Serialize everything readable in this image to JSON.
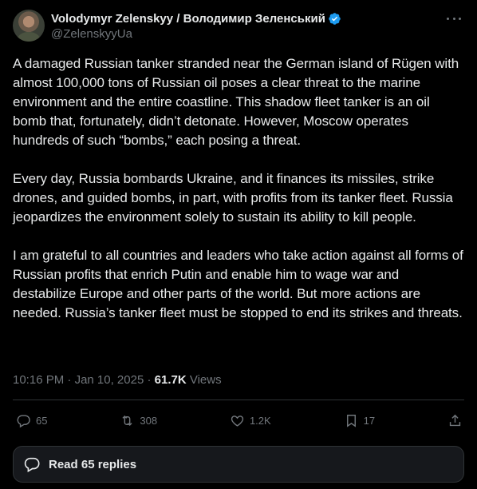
{
  "author": {
    "display_name": "Volodymyr Zelenskyy / Володимир Зеленський",
    "handle": "@ZelenskyyUa",
    "verified_badge_icon": "verified-check-icon",
    "verified_color": "#1d9bf0"
  },
  "post": {
    "paragraphs": [
      "A damaged Russian tanker stranded near the German island of Rügen with almost 100,000 tons of Russian oil poses a clear threat to the marine environment and the entire coastline. This shadow fleet tanker is an oil bomb that, fortunately, didn’t detonate. However, Moscow operates hundreds of such “bombs,” each posing a threat.",
      "Every day, Russia bombards Ukraine, and it finances its missiles, strike drones, and guided bombs, in part, with profits from its tanker fleet. Russia jeopardizes the environment solely to sustain its ability to kill people.",
      "I am grateful to all countries and leaders who take action against all forms of Russian profits that enrich Putin and enable him to wage war and destabilize Europe and other parts of the world. But more actions are needed. Russia’s tanker fleet must be stopped to end its strikes and threats."
    ],
    "time": "10:16 PM",
    "separator": " · ",
    "date": "Jan 10, 2025",
    "views_count": "61.7K",
    "views_label": "Views"
  },
  "actions": {
    "replies": "65",
    "reposts": "308",
    "likes": "1.2K",
    "bookmarks": "17"
  },
  "read_replies_label": "Read 65 replies",
  "colors": {
    "background": "#000000",
    "text_primary": "#e7e9ea",
    "text_secondary": "#71767b",
    "border": "#2f3336"
  }
}
